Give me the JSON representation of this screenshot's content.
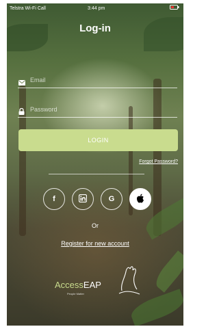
{
  "status_bar": {
    "carrier": "Telstra Wi-Fi Call",
    "time": "3:44 pm"
  },
  "screen": {
    "title": "Log-in"
  },
  "form": {
    "email_placeholder": "Email",
    "password_placeholder": "Password",
    "login_label": "LOGIN",
    "forgot_label": "Forgot Password?"
  },
  "social": {
    "facebook_glyph": "f",
    "linkedin_glyph": "in",
    "google_glyph": "G",
    "apple_glyph": "",
    "buttons": [
      "facebook",
      "linkedin",
      "google",
      "apple"
    ]
  },
  "or_label": "Or",
  "register_label": "Register for new account",
  "brand": {
    "name_prefix": "Access",
    "name_suffix": "EAP",
    "tagline": "People Matter",
    "accent_color": "#c9dc8e"
  }
}
